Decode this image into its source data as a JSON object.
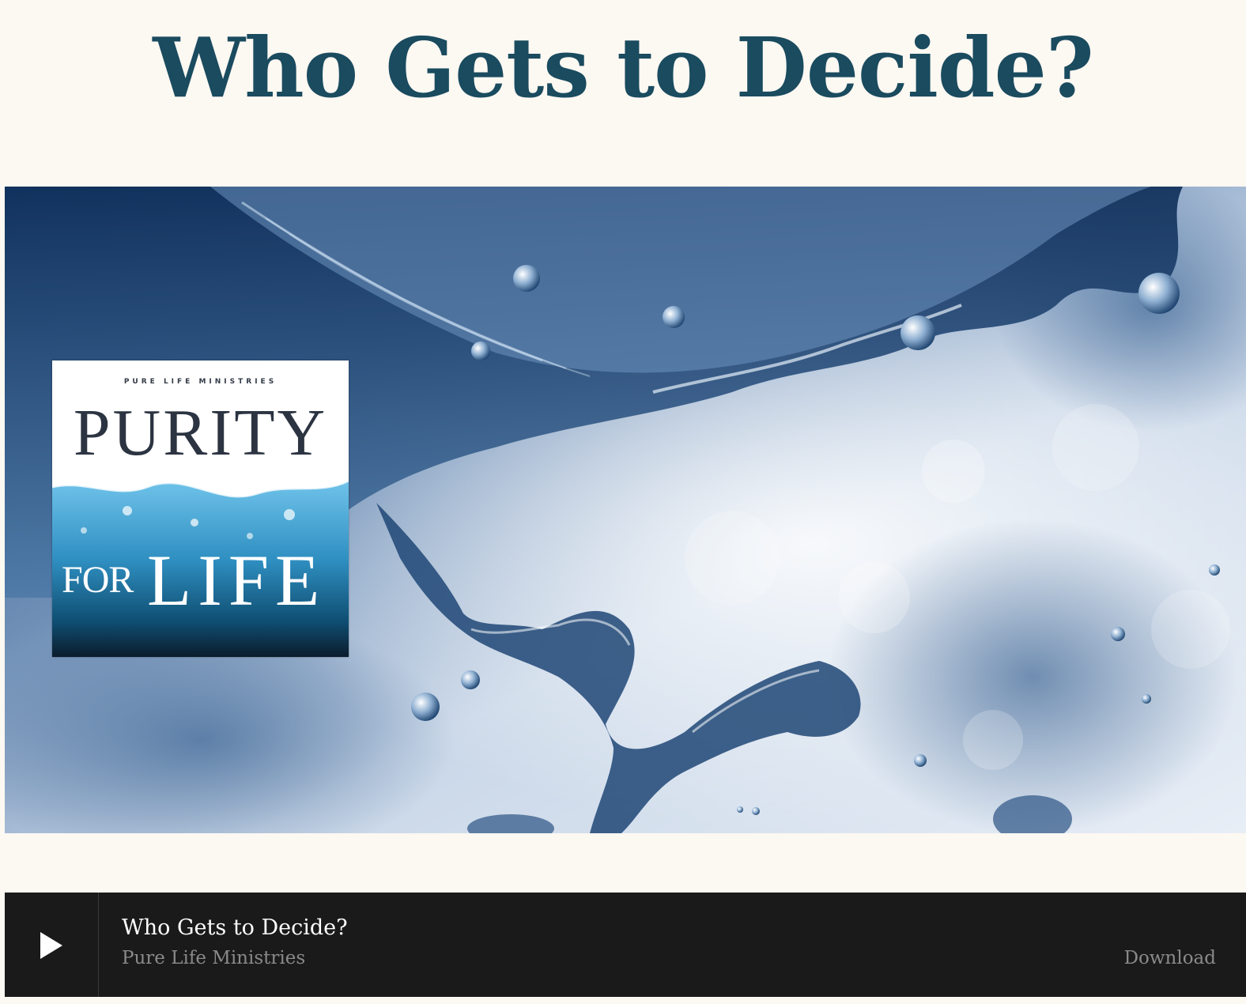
{
  "page": {
    "title": "Who Gets to Decide?"
  },
  "hero": {
    "image_name": "water-splash-photo",
    "cover": {
      "org": "PURE LIFE MINISTRIES",
      "word_top": "PURITY",
      "word_for": "FOR",
      "word_life": "LIFE"
    }
  },
  "player": {
    "track_title": "Who Gets to Decide?",
    "artist": "Pure Life Ministries",
    "download_label": "Download",
    "play_icon": "play-icon"
  },
  "colors": {
    "background": "#fcf8f2",
    "title": "#1a4b5f",
    "player_bg": "#1a1a1a",
    "player_text": "#ffffff",
    "player_muted": "#8a8a8a"
  }
}
